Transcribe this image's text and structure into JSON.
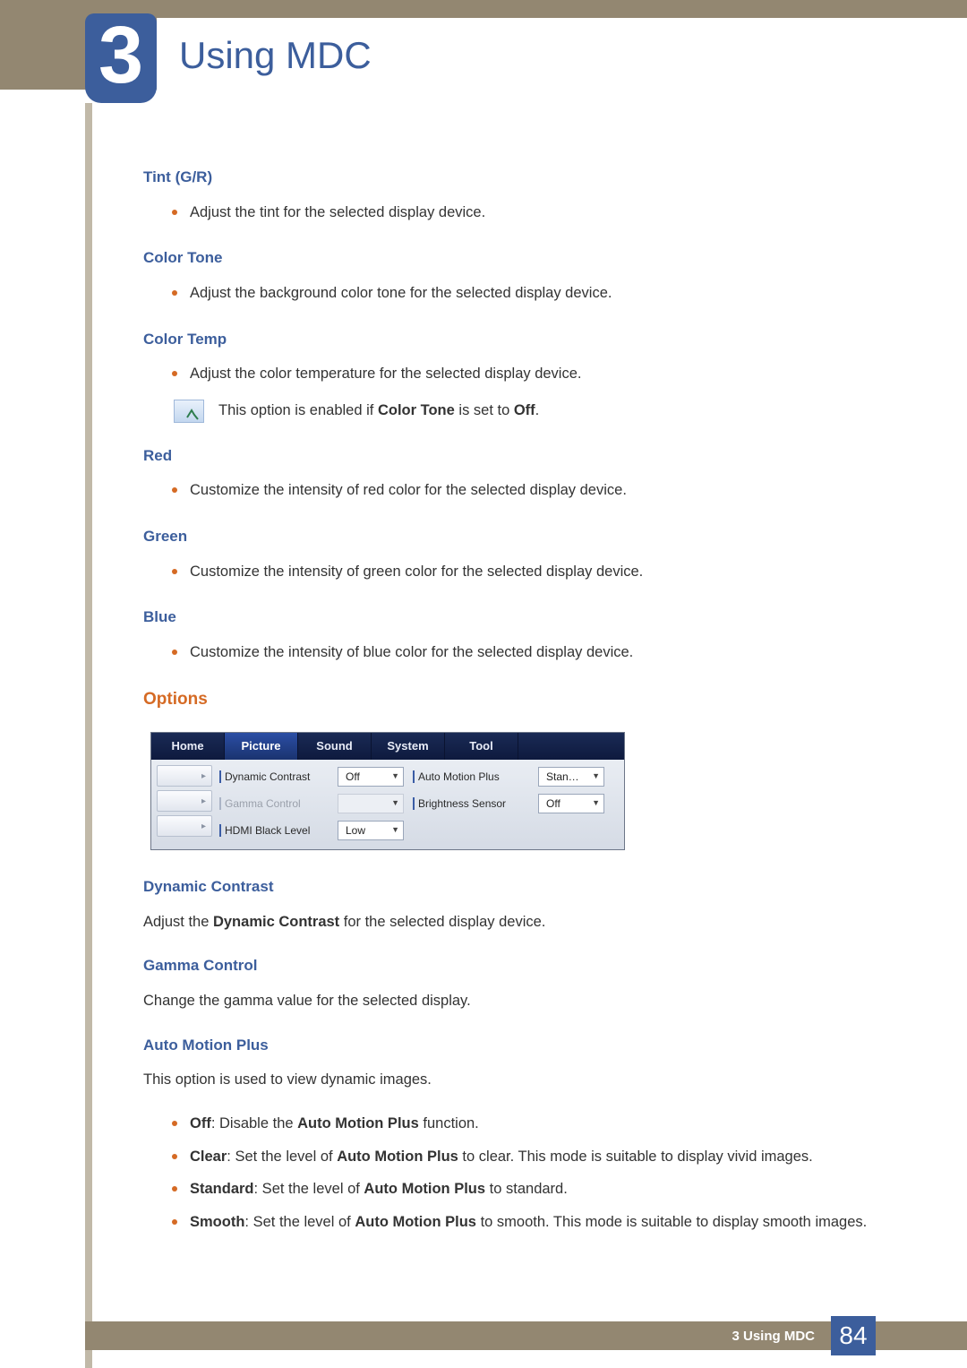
{
  "chapter": {
    "number": "3",
    "title": "Using MDC"
  },
  "sections": {
    "tint": {
      "title": "Tint (G/R)",
      "bullet": "Adjust the tint for the selected display device."
    },
    "colorTone": {
      "title": "Color Tone",
      "bullet": "Adjust the background color tone for the selected display device."
    },
    "colorTemp": {
      "title": "Color Temp",
      "bullet": "Adjust the color temperature for the selected display device.",
      "notePrefix": "This option is enabled if ",
      "noteBold1": "Color Tone",
      "noteMid": " is set to ",
      "noteBold2": "Off",
      "noteSuffix": "."
    },
    "red": {
      "title": "Red",
      "bullet": "Customize the intensity of red color for the selected display device."
    },
    "green": {
      "title": "Green",
      "bullet": "Customize the intensity of green color for the selected display device."
    },
    "blue": {
      "title": "Blue",
      "bullet": "Customize the intensity of blue color for the selected display device."
    }
  },
  "options": {
    "heading": "Options",
    "tabs": {
      "home": "Home",
      "picture": "Picture",
      "sound": "Sound",
      "system": "System",
      "tool": "Tool"
    },
    "fields": {
      "dynamicContrast": {
        "label": "Dynamic Contrast",
        "value": "Off"
      },
      "gammaControl": {
        "label": "Gamma Control",
        "value": ""
      },
      "hdmiBlackLevel": {
        "label": "HDMI Black Level",
        "value": "Low"
      },
      "autoMotionPlus": {
        "label": "Auto Motion Plus",
        "value": "Stan…"
      },
      "brightnessSensor": {
        "label": "Brightness Sensor",
        "value": "Off"
      }
    },
    "expandGlyph": "▸"
  },
  "descriptions": {
    "dynamicContrast": {
      "title": "Dynamic Contrast",
      "body_pre": "Adjust the ",
      "body_bold": "Dynamic Contrast",
      "body_post": " for the selected display device."
    },
    "gammaControl": {
      "title": "Gamma Control",
      "body": "Change the gamma value for the selected display."
    },
    "autoMotionPlus": {
      "title": "Auto Motion Plus",
      "body": "This option is used to view dynamic images.",
      "bullets": {
        "off": {
          "b1": "Off",
          "t1": ": Disable the ",
          "b2": "Auto Motion Plus",
          "t2": " function."
        },
        "clear": {
          "b1": "Clear",
          "t1": ": Set the level of ",
          "b2": "Auto Motion Plus",
          "t2": " to clear. This mode is suitable to display vivid images."
        },
        "standard": {
          "b1": "Standard",
          "t1": ": Set the level of ",
          "b2": "Auto Motion Plus",
          "t2": " to standard."
        },
        "smooth": {
          "b1": "Smooth",
          "t1": ": Set the level of ",
          "b2": "Auto Motion Plus",
          "t2": " to smooth. This mode is suitable to display smooth images."
        }
      }
    }
  },
  "footer": {
    "label": "3 Using MDC",
    "page": "84"
  }
}
